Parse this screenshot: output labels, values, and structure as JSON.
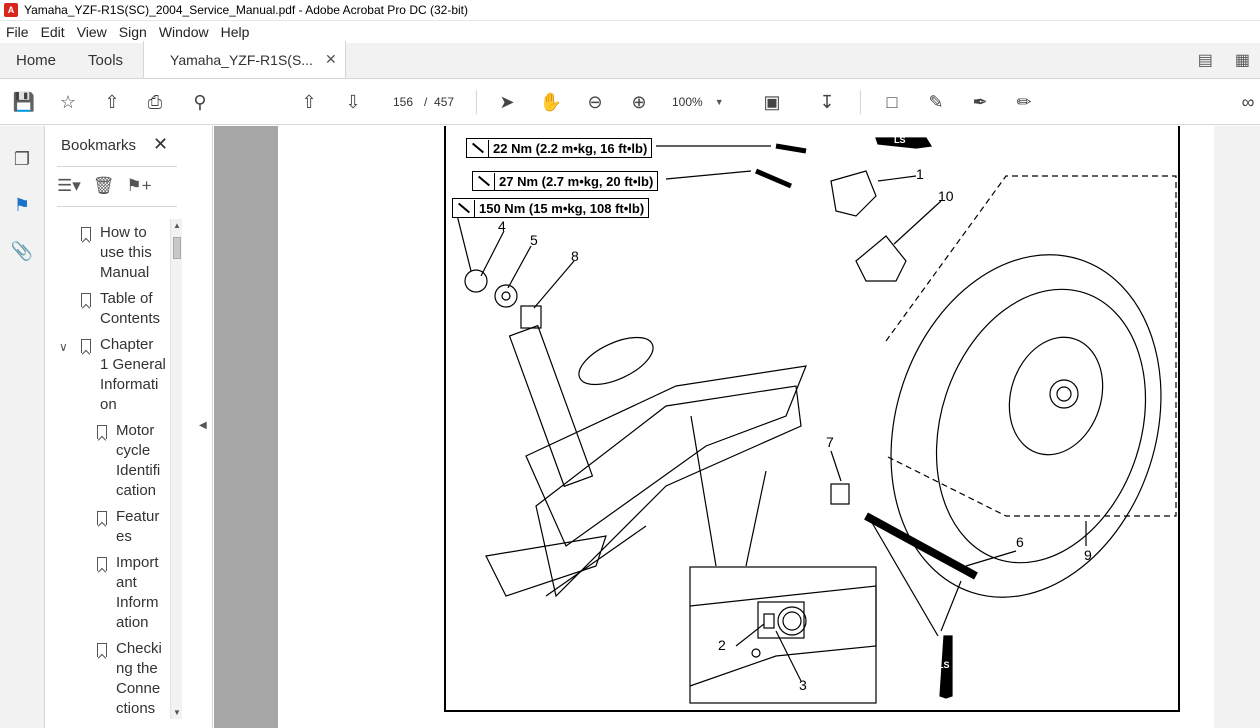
{
  "window": {
    "title": "Yamaha_YZF-R1S(SC)_2004_Service_Manual.pdf - Adobe Acrobat Pro DC (32-bit)"
  },
  "menu": [
    "File",
    "Edit",
    "View",
    "Sign",
    "Window",
    "Help"
  ],
  "tabs": {
    "home": "Home",
    "tools": "Tools",
    "document": "Yamaha_YZF-R1S(S...",
    "close": "✕"
  },
  "toolbar": {
    "page_current": "156",
    "page_separator": "/",
    "page_total": "457",
    "zoom": "100%",
    "icons": [
      "save-icon",
      "bookmark-star-icon",
      "upload-icon",
      "print-icon",
      "search-zoom-icon",
      "page-up-icon",
      "page-down-icon",
      "select-arrow-icon",
      "hand-icon",
      "zoom-out-icon",
      "zoom-in-icon",
      "fit-page-icon",
      "scroll-mode-icon",
      "comment-icon",
      "highlight-icon",
      "sign-icon",
      "edit-icon",
      "link-icon"
    ]
  },
  "bookmarks": {
    "title": "Bookmarks",
    "close": "✕",
    "items": [
      {
        "label": "How to\nuse this\nManual",
        "level": 1
      },
      {
        "label": "Table of\nContents",
        "level": 1
      },
      {
        "label": "Chapter\n1 General\nInformati\non",
        "level": 1,
        "expanded": true
      },
      {
        "label": "Motor\ncycle\nIdentifi\ncation",
        "level": 2
      },
      {
        "label": "Featur\nes",
        "level": 2
      },
      {
        "label": "Import\nant\nInform\nation",
        "level": 2
      },
      {
        "label": "Checki\nng the\nConne\nctions",
        "level": 2
      }
    ]
  },
  "diagram": {
    "torques": [
      "22 Nm (2.2 m•kg, 16 ft•lb)",
      "27 Nm (2.7 m•kg, 20 ft•lb)",
      "150 Nm (15 m•kg, 108 ft•lb)"
    ],
    "callouts": [
      "1",
      "10",
      "4",
      "5",
      "8",
      "7",
      "6",
      "9",
      "2",
      "3"
    ],
    "ls_label": "LS"
  }
}
